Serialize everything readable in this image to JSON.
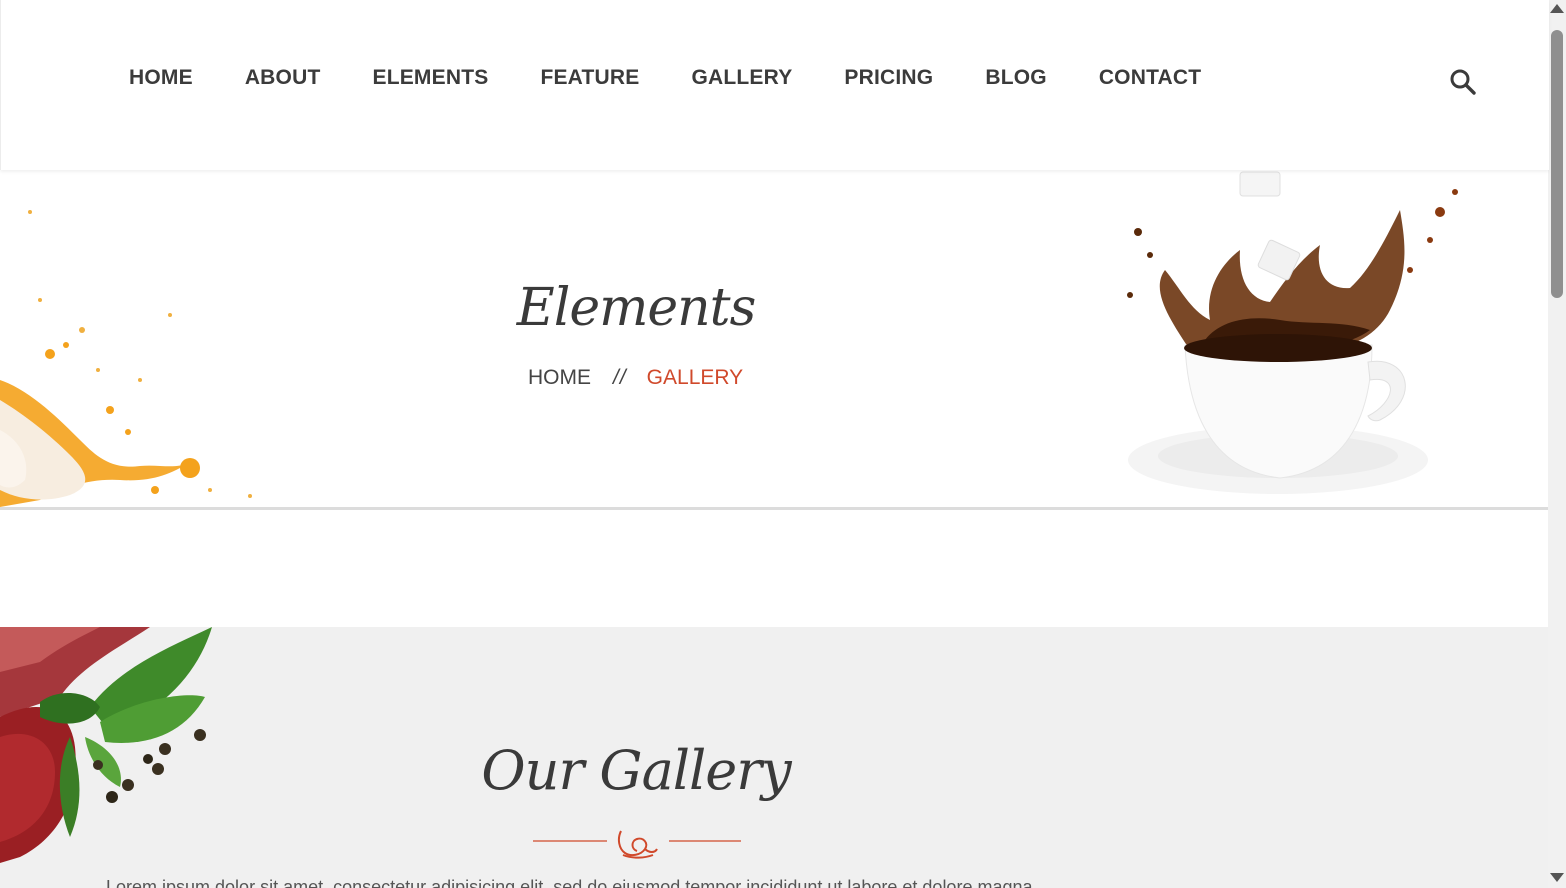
{
  "nav": {
    "items": [
      "HOME",
      "ABOUT",
      "ELEMENTS",
      "FEATURE",
      "GALLERY",
      "PRICING",
      "BLOG",
      "CONTACT"
    ],
    "search_icon": "search-icon"
  },
  "banner": {
    "title": "Elements",
    "breadcrumb": {
      "home": "HOME",
      "separator": "//",
      "current": "GALLERY"
    },
    "left_decoration": "orange-juice-splash",
    "right_decoration": "coffee-cup-splash"
  },
  "gallery": {
    "title": "Our Gallery",
    "divider_icon": "ornament-icon",
    "text": "Lorem ipsum dolor sit amet, consectetur adipisicing elit, sed do eiusmod tempor incididunt ut labore et dolore magna",
    "corner_decoration": "raw-meat-basil-pepper"
  },
  "colors": {
    "accent": "#d0492b",
    "text": "#3b3b3b",
    "section_bg": "#f0f0f0"
  }
}
